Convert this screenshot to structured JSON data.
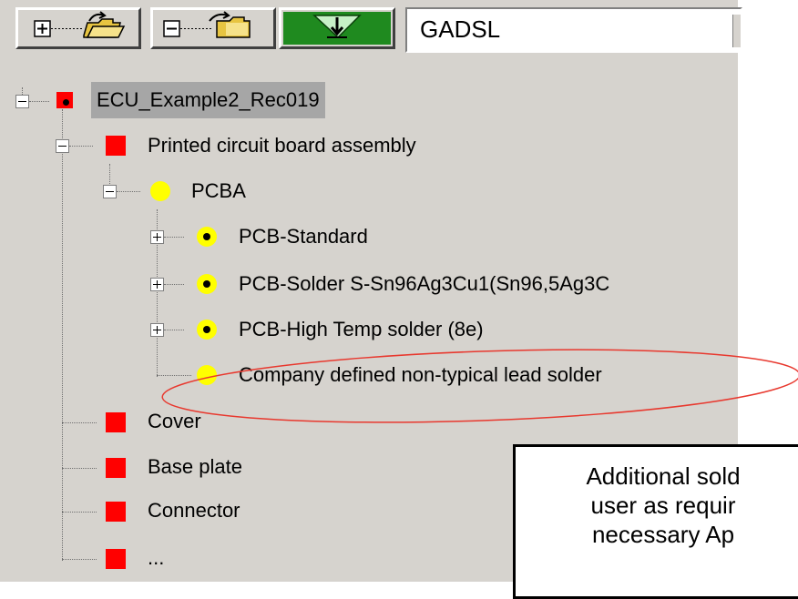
{
  "toolbar": {
    "expand_all_icon": "expand-all-folder-icon",
    "collapse_all_icon": "collapse-all-folder-icon",
    "filter_icon": "filter-funnel-icon",
    "filter_value": "GADSL"
  },
  "tree": {
    "root": {
      "label": "ECU_Example2_Rec019",
      "icon": "red-square-dot"
    },
    "assembly": {
      "label": "Printed circuit board assembly",
      "icon": "red-square"
    },
    "pcba": {
      "label": "PCBA",
      "icon": "yellow-circle"
    },
    "pcb_standard": {
      "label": "PCB-Standard",
      "icon": "yellow-circle-dot"
    },
    "pcb_solder": {
      "label": "PCB-Solder S-Sn96Ag3Cu1(Sn96,5Ag3C",
      "icon": "yellow-circle-dot"
    },
    "pcb_high_temp": {
      "label": "PCB-High Temp solder (8e)",
      "icon": "yellow-circle-dot"
    },
    "company_solder": {
      "label": "Company defined non-typical lead solder",
      "icon": "yellow-circle"
    },
    "cover": {
      "label": "Cover",
      "icon": "red-square"
    },
    "base_plate": {
      "label": "Base plate",
      "icon": "red-square"
    },
    "connector": {
      "label": "Connector",
      "icon": "red-square"
    },
    "more": {
      "label": "...",
      "icon": "red-square"
    }
  },
  "note": {
    "line1": "Additional sold",
    "line2": "user as requir",
    "line3": "necessary Ap"
  },
  "colors": {
    "panel_bg": "#d6d3ce",
    "root_highlight": "#a6a6a6",
    "red_node": "#ff0000",
    "yellow_node": "#ffff00",
    "annotation_ellipse": "#e8382e",
    "filter_button": "#1f8a1f"
  }
}
